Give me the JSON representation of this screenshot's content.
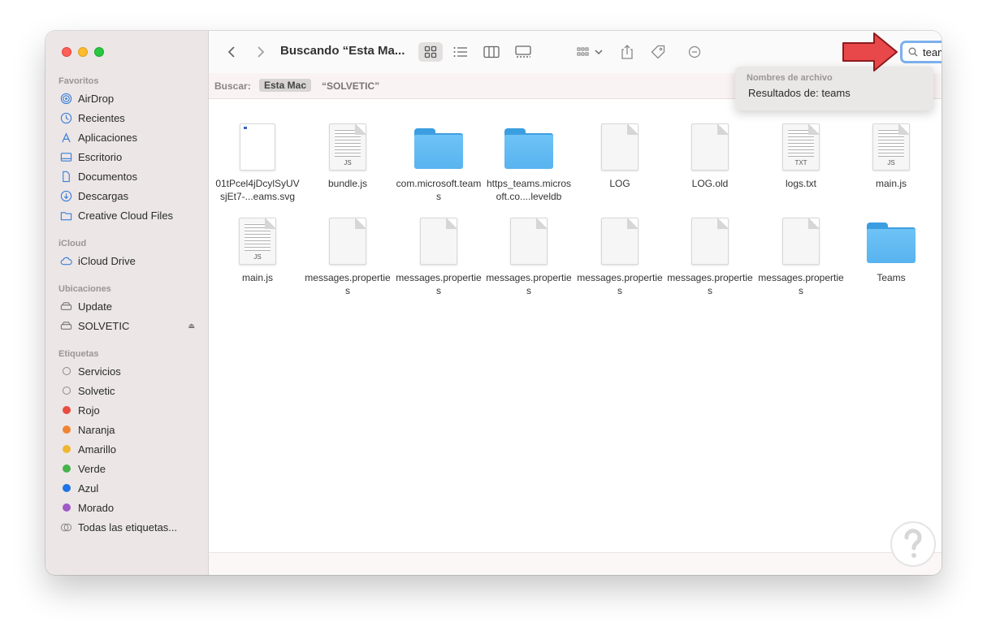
{
  "window": {
    "title": "Buscando “Esta Ma...",
    "search": {
      "query": "teams"
    },
    "suggestions": {
      "header": "Nombres de archivo",
      "result": "Resultados de: teams"
    },
    "scope": {
      "label": "Buscar:",
      "options": [
        "Esta Mac",
        "“SOLVETIC”"
      ],
      "selected": "Esta Mac"
    }
  },
  "sidebar": {
    "favorites": {
      "title": "Favoritos",
      "items": [
        {
          "label": "AirDrop",
          "icon": "airdrop-icon"
        },
        {
          "label": "Recientes",
          "icon": "clock-icon"
        },
        {
          "label": "Aplicaciones",
          "icon": "applications-icon"
        },
        {
          "label": "Escritorio",
          "icon": "desktop-icon"
        },
        {
          "label": "Documentos",
          "icon": "document-icon"
        },
        {
          "label": "Descargas",
          "icon": "download-icon"
        },
        {
          "label": "Creative Cloud Files",
          "icon": "folder-icon"
        }
      ]
    },
    "icloud": {
      "title": "iCloud",
      "items": [
        {
          "label": "iCloud Drive",
          "icon": "cloud-icon"
        }
      ]
    },
    "locations": {
      "title": "Ubicaciones",
      "items": [
        {
          "label": "Update",
          "icon": "disk-icon"
        },
        {
          "label": "SOLVETIC",
          "icon": "disk-icon"
        }
      ]
    },
    "tags": {
      "title": "Etiquetas",
      "items": [
        {
          "label": "Servicios",
          "color": ""
        },
        {
          "label": "Solvetic",
          "color": ""
        },
        {
          "label": "Rojo",
          "color": "#ea4c41"
        },
        {
          "label": "Naranja",
          "color": "#f08434"
        },
        {
          "label": "Amarillo",
          "color": "#efb632"
        },
        {
          "label": "Verde",
          "color": "#45b34a"
        },
        {
          "label": "Azul",
          "color": "#1f74e6"
        },
        {
          "label": "Morado",
          "color": "#a05ac6"
        },
        {
          "label": "Todas las etiquetas...",
          "color": ""
        }
      ]
    }
  },
  "files": [
    {
      "name": "01tPcel4jDcylSyUVsjEt7-...eams.svg",
      "kind": "svg"
    },
    {
      "name": "bundle.js",
      "kind": "doc",
      "ext": "JS"
    },
    {
      "name": "com.microsoft.teams",
      "kind": "folder"
    },
    {
      "name": "https_teams.microsoft.co....leveldb",
      "kind": "folder"
    },
    {
      "name": "LOG",
      "kind": "blank"
    },
    {
      "name": "LOG.old",
      "kind": "blank"
    },
    {
      "name": "logs.txt",
      "kind": "doc",
      "ext": "TXT"
    },
    {
      "name": "main.js",
      "kind": "doc",
      "ext": "JS"
    },
    {
      "name": "main.js",
      "kind": "doc",
      "ext": "JS"
    },
    {
      "name": "messages.properties",
      "kind": "blank"
    },
    {
      "name": "messages.properties",
      "kind": "blank"
    },
    {
      "name": "messages.properties",
      "kind": "blank"
    },
    {
      "name": "messages.properties",
      "kind": "blank"
    },
    {
      "name": "messages.properties",
      "kind": "blank"
    },
    {
      "name": "messages.properties",
      "kind": "blank"
    },
    {
      "name": "Teams",
      "kind": "folder"
    }
  ],
  "colors": {
    "search_focus": "#7cb0ee",
    "folder_blue": "#5fb8f2",
    "arrow_red": "#e8484a"
  }
}
